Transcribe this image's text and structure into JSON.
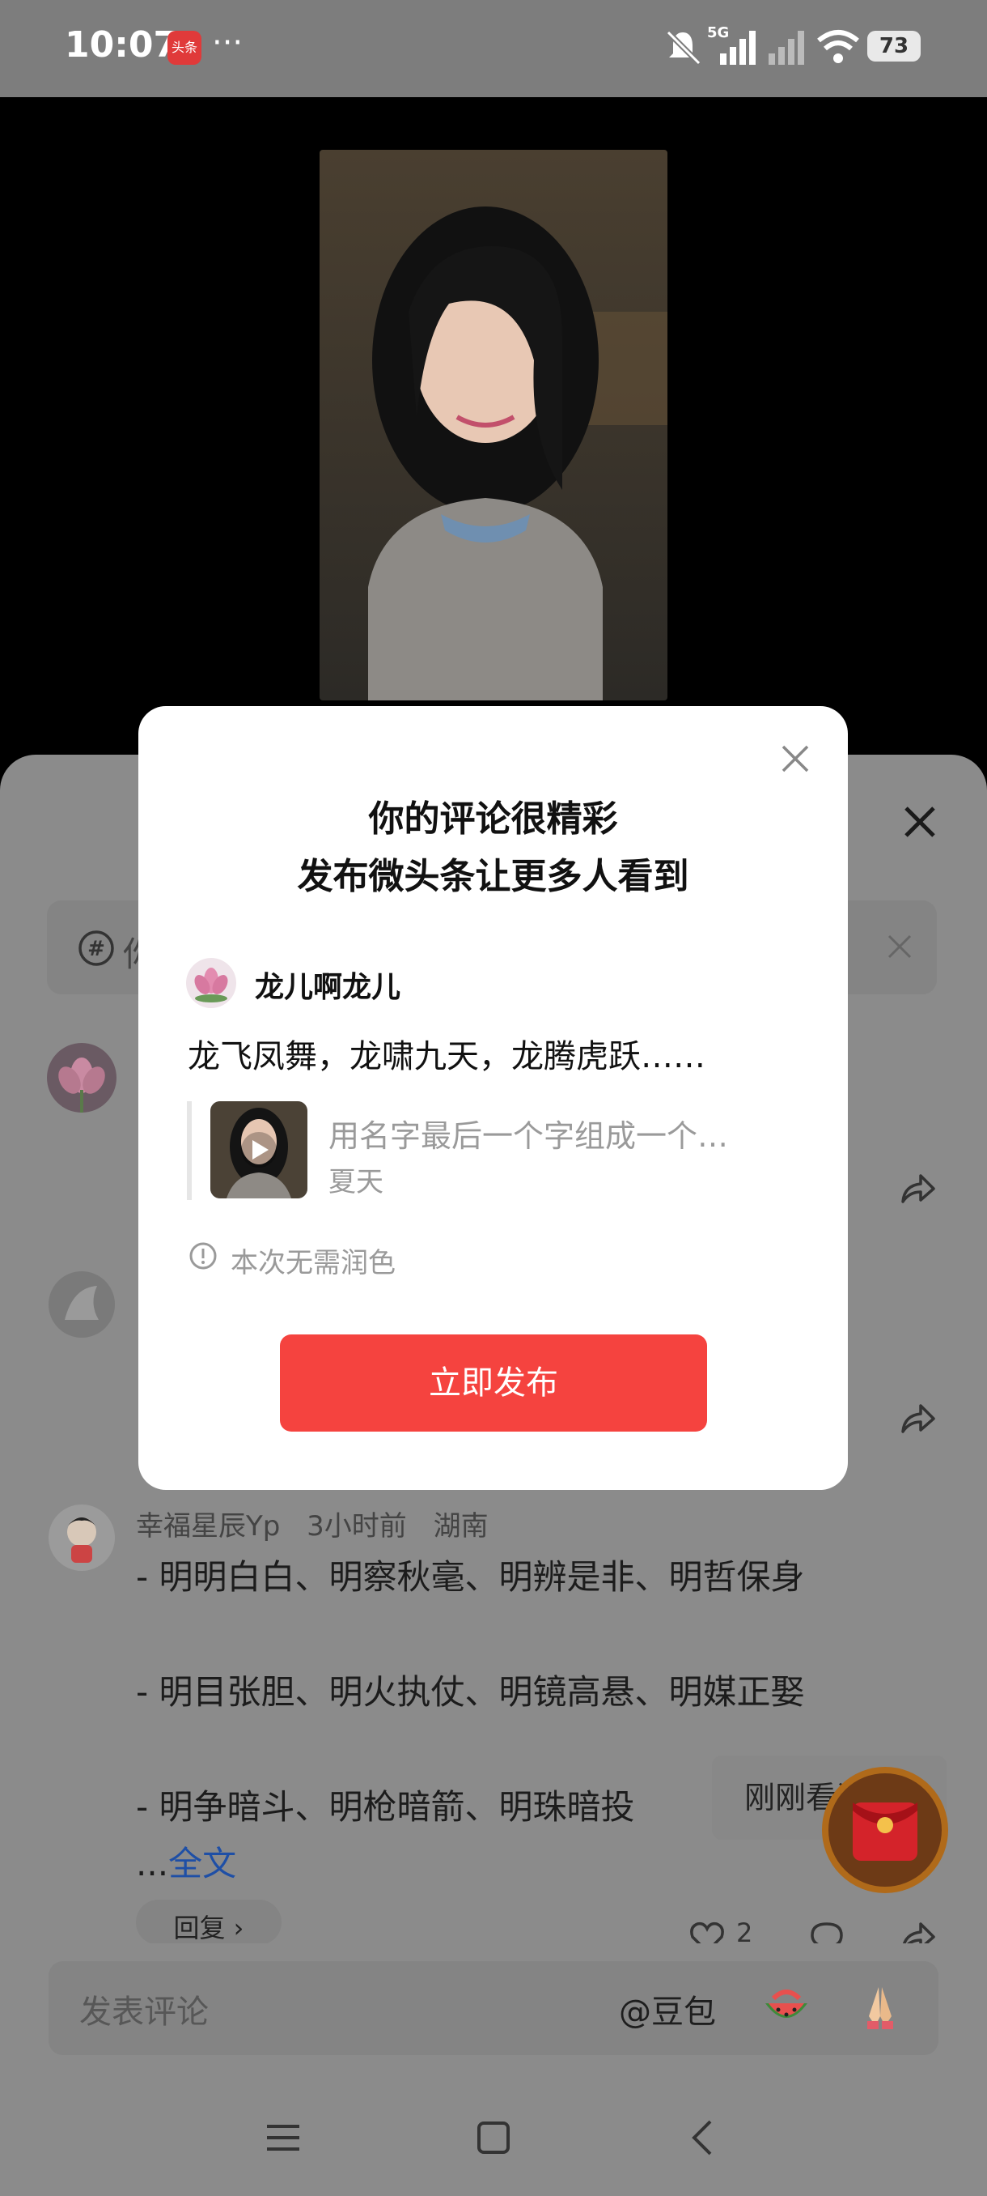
{
  "status_bar": {
    "time": "10:07",
    "app_badge": "头条",
    "more": "···",
    "network": "5G",
    "battery": "73"
  },
  "dialog": {
    "title_line1": "你的评论很精彩",
    "title_line2": "发布微头条让更多人看到",
    "username": "龙儿啊龙儿",
    "comment_text": "龙飞凤舞，龙啸九天，龙腾虎跃……",
    "quote_title": "用名字最后一个字组成一个…",
    "quote_author": "夏天",
    "hint": "本次无需润色",
    "publish_label": "立即发布"
  },
  "background_comments": {
    "topic_prefix": "你",
    "third_comment": {
      "username": "幸福星辰Yp",
      "time": "3小时前",
      "location": "湖南",
      "lines": [
        "- 明明白白、明察秋毫、明辨是非、明哲保身",
        "- 明目张胆、明火执仗、明镜高悬、明媒正娶",
        "- 明争暗斗、明枪暗箭、明珠暗投"
      ],
      "ellipsis": "...",
      "full_text_link": "全文",
      "reply_label": "回复 ›",
      "like_count": "2"
    }
  },
  "recent_popup": "刚刚看过",
  "bottom_bar": {
    "placeholder": "发表评论",
    "doubao": "@豆包"
  },
  "colors": {
    "accent_red": "#f5433f",
    "overlay_gray": "#8b8b8b",
    "link_blue": "#1e4fa6"
  }
}
